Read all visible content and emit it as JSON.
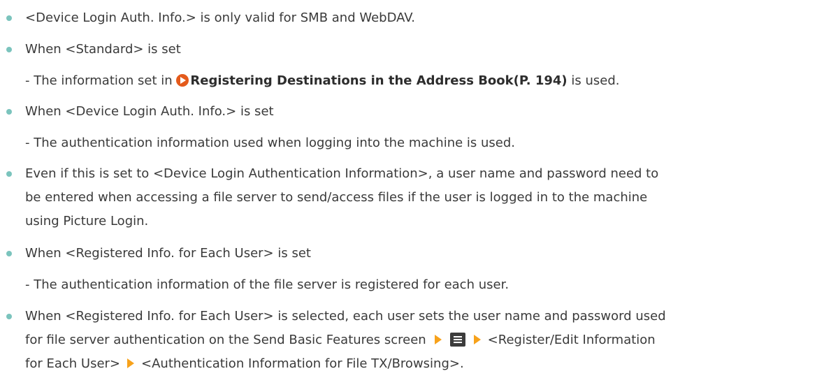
{
  "notes": {
    "b1": "<Device Login Auth. Info.> is only valid for SMB and WebDAV.",
    "b2": "When <Standard> is set",
    "s2_pre": "- The information set in ",
    "s2_link": "Registering Destinations in the Address Book(P. 194)",
    "s2_post": "  is used.",
    "b3": "When <Device Login Auth. Info.> is set",
    "s3": "- The authentication information used when logging into the machine is used.",
    "b4_l1": "Even if this is set to <Device Login Authentication Information>, a user name and password need to",
    "b4_l2": "be entered when accessing a file server to send/access files if the user is logged in to the machine",
    "b4_l3": "using Picture Login.",
    "b5": "When <Registered Info. for Each User> is set",
    "s5": "- The authentication information of the file server is registered for each user.",
    "b6_l1": "When <Registered Info. for Each User> is selected, each user sets the user name and password used",
    "b6_l2_pre": "for file server authentication on the Send Basic Features screen",
    "b6_l2_post": "<Register/Edit Information",
    "b6_l3_pre": "for Each User>",
    "b6_l3_post": "<Authentication Information for File TX/Browsing>."
  },
  "icons": {
    "bullet": "bullet-dot",
    "xref": "reference-link-icon",
    "arrow": "step-arrow-icon",
    "menu": "menu-icon"
  },
  "colors": {
    "bullet": "#7bc4bd",
    "xref_icon": "#e45a1b",
    "arrow": "#f7a21b",
    "text": "#3a3a3a"
  }
}
